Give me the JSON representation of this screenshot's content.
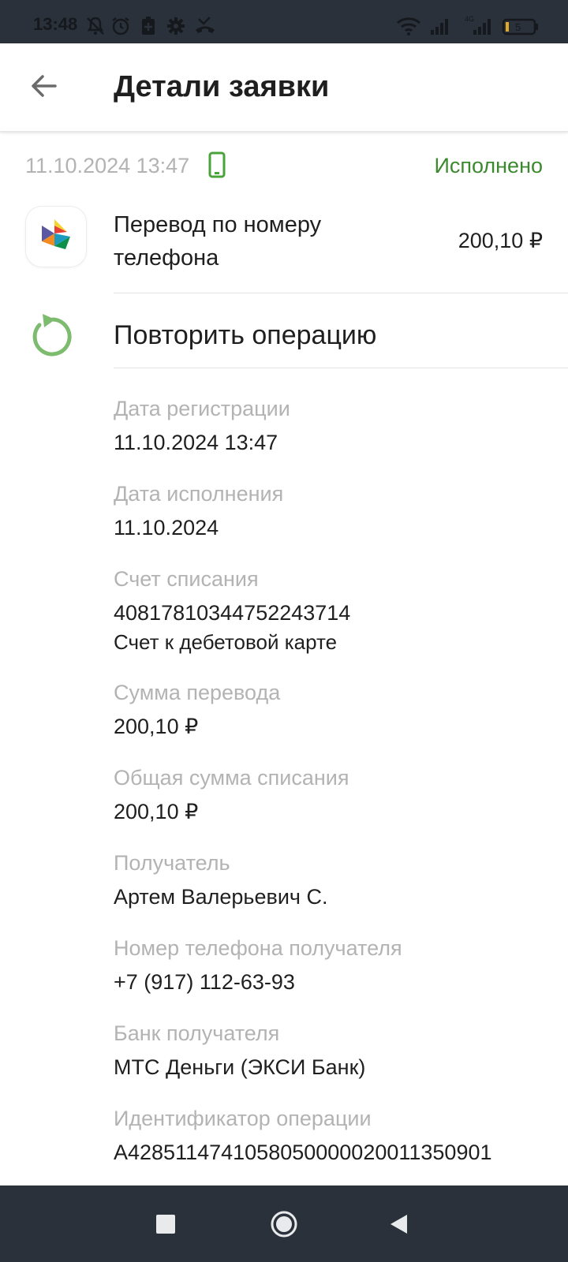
{
  "status_bar": {
    "time": "13:48",
    "left_icons": [
      "bell-off-icon",
      "alarm-icon",
      "battery-saver-icon",
      "gear-icon",
      "missed-call-icon"
    ],
    "right_icons": [
      "wifi-icon",
      "signal-icon",
      "signal-4g-icon",
      "battery-icon"
    ],
    "network_label": "4G",
    "battery_level": "5"
  },
  "app_bar": {
    "title": "Детали заявки",
    "back_icon": "arrow-left-icon"
  },
  "summary": {
    "datetime": "11.10.2024 13:47",
    "device_icon": "smartphone-icon",
    "status": "Исполнено",
    "status_color": "#3c8a2f",
    "operation_name": "Перевод по номеру телефона",
    "amount": "200,10 ₽",
    "logo_icon": "sbp-logo-icon"
  },
  "repeat": {
    "label": "Повторить операцию",
    "icon": "repeat-arrow-icon",
    "icon_color": "#7dbb6f"
  },
  "details": [
    {
      "label": "Дата регистрации",
      "value": "11.10.2024 13:47"
    },
    {
      "label": "Дата исполнения",
      "value": "11.10.2024"
    },
    {
      "label": "Счет списания",
      "value": "40817810344752243714",
      "sub": "Счет к дебетовой карте"
    },
    {
      "label": "Сумма перевода",
      "value": "200,10 ₽"
    },
    {
      "label": "Общая сумма списания",
      "value": "200,10 ₽"
    },
    {
      "label": "Получатель",
      "value": "Артем Валерьевич С."
    },
    {
      "label": "Номер телефона получателя",
      "value": "+7 (917) 112-63-93"
    },
    {
      "label": "Банк получателя",
      "value": "МТС Деньги (ЭКСИ Банк)"
    },
    {
      "label": "Идентификатор операции",
      "value": "A4285114741058050000020011350901"
    }
  ],
  "nav_bar": {
    "recents_icon": "square-icon",
    "home_icon": "circle-icon",
    "back_icon": "triangle-back-icon"
  }
}
